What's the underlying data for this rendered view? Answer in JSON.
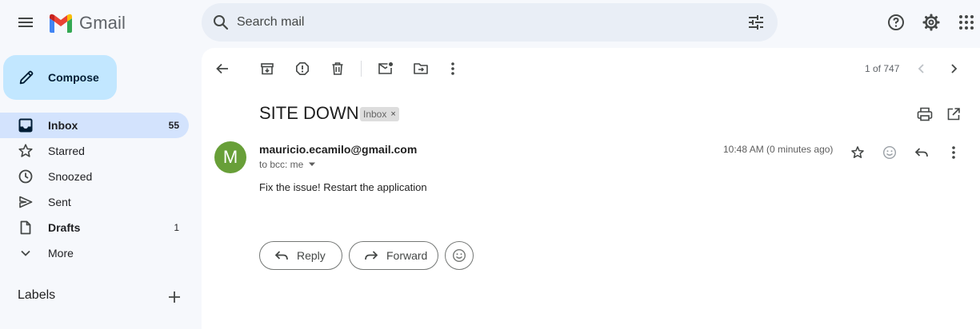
{
  "app": {
    "name": "Gmail"
  },
  "search": {
    "placeholder": "Search mail"
  },
  "compose": {
    "label": "Compose"
  },
  "sidebar": {
    "items": [
      {
        "label": "Inbox",
        "count": "55",
        "active": true,
        "bold": true,
        "icon": "inbox-icon"
      },
      {
        "label": "Starred",
        "count": "",
        "active": false,
        "bold": false,
        "icon": "star-icon"
      },
      {
        "label": "Snoozed",
        "count": "",
        "active": false,
        "bold": false,
        "icon": "clock-icon"
      },
      {
        "label": "Sent",
        "count": "",
        "active": false,
        "bold": false,
        "icon": "send-icon"
      },
      {
        "label": "Drafts",
        "count": "1",
        "active": false,
        "bold": true,
        "icon": "draft-icon"
      },
      {
        "label": "More",
        "count": "",
        "active": false,
        "bold": false,
        "icon": "chevron-down-icon"
      }
    ],
    "labels_title": "Labels"
  },
  "toolbar": {
    "pager": "1 of 747"
  },
  "email": {
    "subject": "SITE DOWN",
    "label_chip": "Inbox",
    "chip_close": "×",
    "avatar_letter": "M",
    "sender": "mauricio.ecamilo@gmail.com",
    "recipients": "to bcc: me",
    "timestamp": "10:48 AM (0 minutes ago)",
    "body": "Fix the issue! Restart the application"
  },
  "actions": {
    "reply": "Reply",
    "forward": "Forward"
  },
  "colors": {
    "accent": "#0b57d0",
    "compose_bg": "#c2e7ff",
    "active_nav": "#d3e3fd",
    "avatar": "#689f38",
    "background": "#f6f8fc"
  }
}
